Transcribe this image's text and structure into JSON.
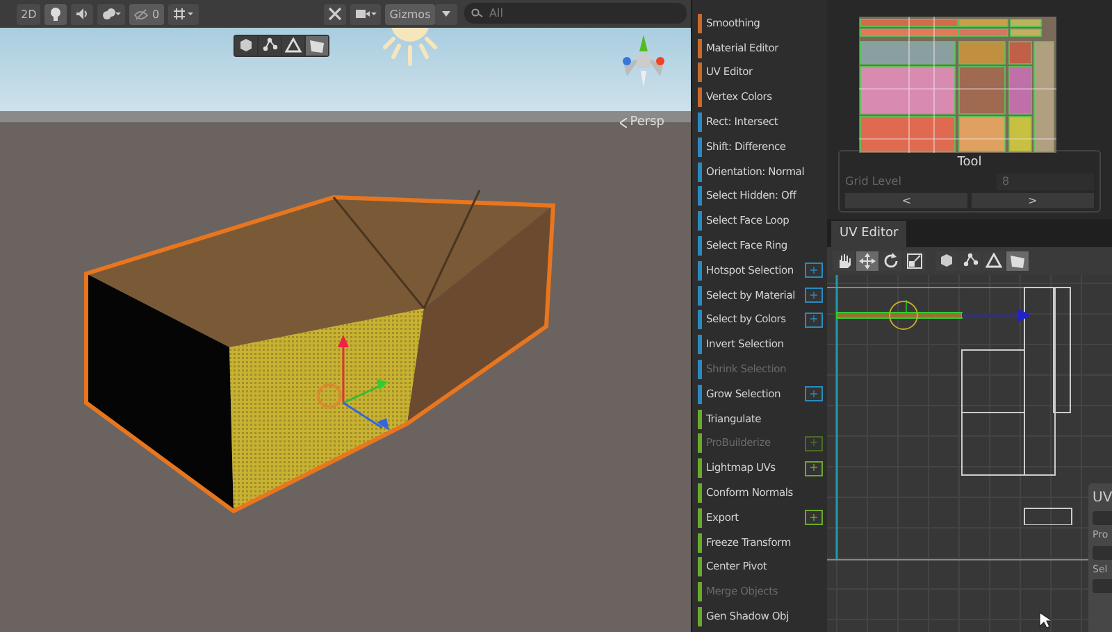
{
  "scene_toolbar": {
    "mode_button": "2D",
    "hidden_count": "0",
    "gizmos": "Gizmos",
    "search": {
      "placeholder": "All"
    }
  },
  "scene_view": {
    "projection": "Persp",
    "edit_modes": [
      {
        "selected": false
      },
      {
        "selected": false
      },
      {
        "selected": false
      },
      {
        "selected": true
      }
    ]
  },
  "probuilder": {
    "items": [
      {
        "label": "Smoothing",
        "color": "#c96a2a",
        "disabled": false
      },
      {
        "label": "Material Editor",
        "color": "#c96a2a",
        "disabled": false
      },
      {
        "label": "UV Editor",
        "color": "#c96a2a",
        "disabled": false
      },
      {
        "label": "Vertex Colors",
        "color": "#c96a2a",
        "disabled": false
      },
      {
        "label": "Rect: Intersect",
        "color": "#2a8ac0",
        "disabled": false
      },
      {
        "label": "Shift: Difference",
        "color": "#2a8ac0",
        "disabled": false
      },
      {
        "label": "Orientation: Normal",
        "color": "#2a8ac0",
        "disabled": false
      },
      {
        "label": "Select Hidden: Off",
        "color": "#2a8ac0",
        "disabled": false
      },
      {
        "label": "Select Face Loop",
        "color": "#2a8ac0",
        "disabled": false
      },
      {
        "label": "Select Face Ring",
        "color": "#2a8ac0",
        "disabled": false
      },
      {
        "label": "Hotspot Selection",
        "color": "#2a8ac0",
        "disabled": false,
        "option": "+"
      },
      {
        "label": "Select by Material",
        "color": "#2a8ac0",
        "disabled": false,
        "option": "+"
      },
      {
        "label": "Select by Colors",
        "color": "#2a8ac0",
        "disabled": false,
        "option": "+"
      },
      {
        "label": "Invert Selection",
        "color": "#2a8ac0",
        "disabled": false
      },
      {
        "label": "Shrink Selection",
        "color": "#2a8ac0",
        "disabled": true
      },
      {
        "label": "Grow Selection",
        "color": "#2a8ac0",
        "disabled": false,
        "option": "+"
      },
      {
        "label": "Triangulate",
        "color": "#6aaa2a",
        "disabled": false
      },
      {
        "label": "ProBuilderize",
        "color": "#6aaa2a",
        "disabled": true,
        "option": "+"
      },
      {
        "label": "Lightmap UVs",
        "color": "#6aaa2a",
        "disabled": false,
        "option": "+"
      },
      {
        "label": "Conform Normals",
        "color": "#6aaa2a",
        "disabled": false
      },
      {
        "label": "Export",
        "color": "#6aaa2a",
        "disabled": false,
        "option": "+"
      },
      {
        "label": "Freeze Transform",
        "color": "#6aaa2a",
        "disabled": false
      },
      {
        "label": "Center Pivot",
        "color": "#6aaa2a",
        "disabled": false
      },
      {
        "label": "Merge Objects",
        "color": "#6aaa2a",
        "disabled": true
      },
      {
        "label": "Gen Shadow Obj",
        "color": "#6aaa2a",
        "disabled": false
      }
    ]
  },
  "rect_packer": {
    "tool_title": "Tool",
    "grid_level_label": "Grid Level",
    "grid_level": "8",
    "prev_button": "<",
    "next_button": ">"
  },
  "uv_editor": {
    "tab": "UV Editor",
    "tools": [
      {
        "selected": false
      },
      {
        "selected": true
      },
      {
        "selected": false
      },
      {
        "selected": false
      }
    ],
    "edit_modes": [
      {
        "selected": false
      },
      {
        "selected": false
      },
      {
        "selected": false
      },
      {
        "selected": true
      }
    ],
    "side_panel": {
      "title": "UV",
      "labels": [
        "Pro",
        "Sel"
      ]
    }
  }
}
